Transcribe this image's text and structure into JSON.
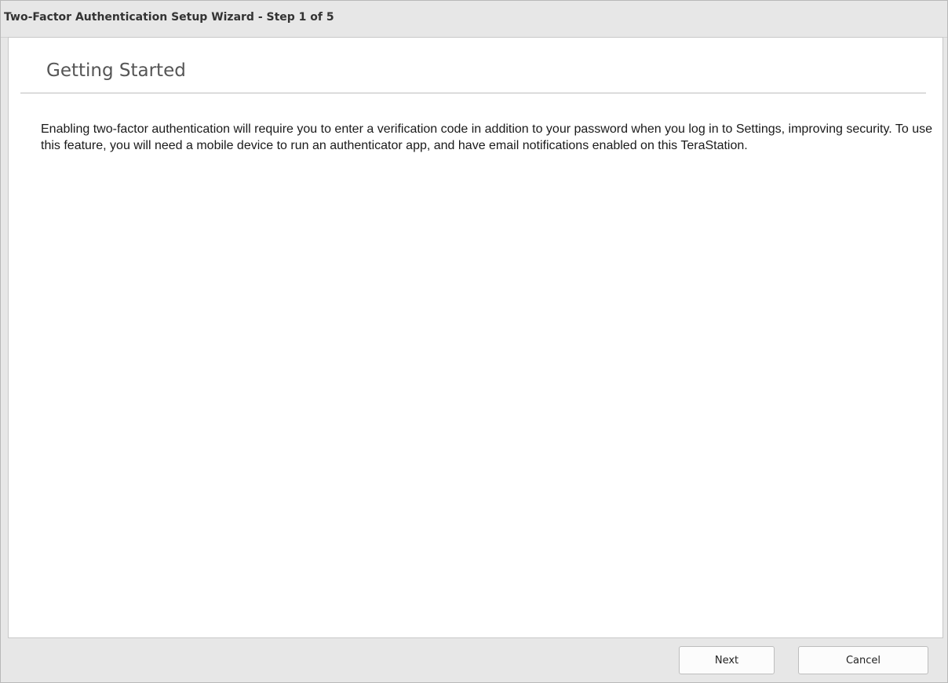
{
  "window": {
    "title": "Two-Factor Authentication Setup Wizard - Step 1 of 5"
  },
  "page": {
    "heading": "Getting Started",
    "description": "Enabling two-factor authentication will require you to enter a verification code in addition to your password when you log in to Settings, improving security. To use this feature, you will need a mobile device to run an authenticator app, and have email notifications enabled on this TeraStation."
  },
  "buttons": {
    "next_label": "Next",
    "cancel_label": "Cancel"
  }
}
